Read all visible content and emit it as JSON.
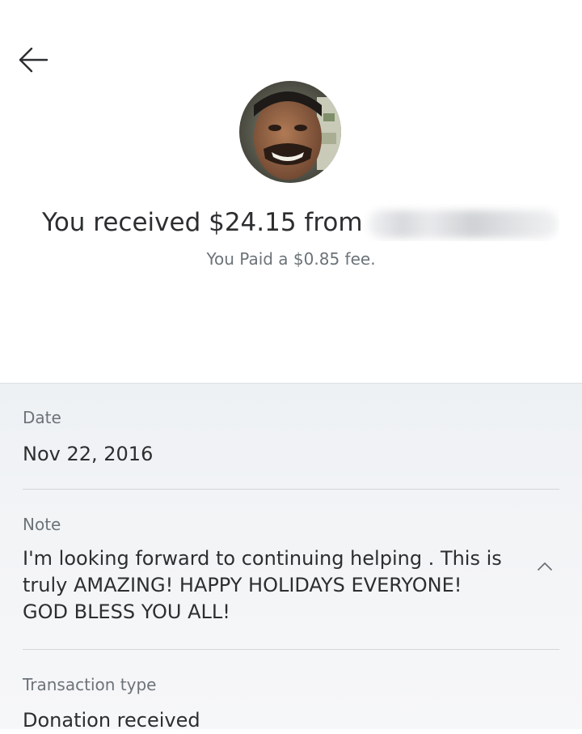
{
  "header": {
    "back_icon": "arrow-left-icon",
    "avatar_icon": "user-avatar"
  },
  "summary": {
    "headline_prefix": "You received $24.15 from",
    "fee_text": "You Paid a $0.85 fee."
  },
  "details": {
    "date": {
      "label": "Date",
      "value": "Nov 22, 2016"
    },
    "note": {
      "label": "Note",
      "value": "I'm looking forward to continuing helping . This is truly AMAZING! HAPPY HOLIDAYS EVERYONE! GOD BLESS YOU ALL!",
      "toggle_icon": "chevron-up-icon"
    },
    "transaction_type": {
      "label": "Transaction type",
      "value": "Donation received"
    }
  },
  "colors": {
    "text_primary": "#2c2e2f",
    "text_secondary": "#6c7378",
    "details_background": "#eef1f4"
  }
}
